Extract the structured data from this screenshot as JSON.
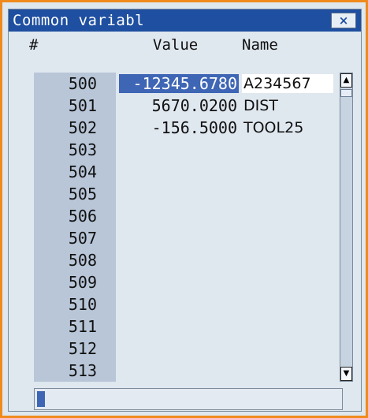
{
  "window": {
    "title": "Common variabl",
    "close_label": "×",
    "frame_color": "#f08a1c",
    "titlebar_color": "#1f4fa0"
  },
  "columns": {
    "number": "#",
    "value": "Value",
    "name": "Name"
  },
  "rows": [
    {
      "num": "500",
      "value": "-12345.6780",
      "name": "A234567"
    },
    {
      "num": "501",
      "value": "5670.0200",
      "name": "DIST"
    },
    {
      "num": "502",
      "value": "-156.5000",
      "name": "TOOL25"
    },
    {
      "num": "503",
      "value": "",
      "name": ""
    },
    {
      "num": "504",
      "value": "",
      "name": ""
    },
    {
      "num": "505",
      "value": "",
      "name": ""
    },
    {
      "num": "506",
      "value": "",
      "name": ""
    },
    {
      "num": "507",
      "value": "",
      "name": ""
    },
    {
      "num": "508",
      "value": "",
      "name": ""
    },
    {
      "num": "509",
      "value": "",
      "name": ""
    },
    {
      "num": "510",
      "value": "",
      "name": ""
    },
    {
      "num": "511",
      "value": "",
      "name": ""
    },
    {
      "num": "512",
      "value": "",
      "name": ""
    },
    {
      "num": "513",
      "value": "",
      "name": ""
    }
  ],
  "selection": {
    "selected_row": 0,
    "editing_name_row": 0
  },
  "scrollbar": {
    "up_icon": "scroll-up-arrow-icon",
    "down_icon": "scroll-down-arrow-icon"
  },
  "input": {
    "value": ""
  }
}
